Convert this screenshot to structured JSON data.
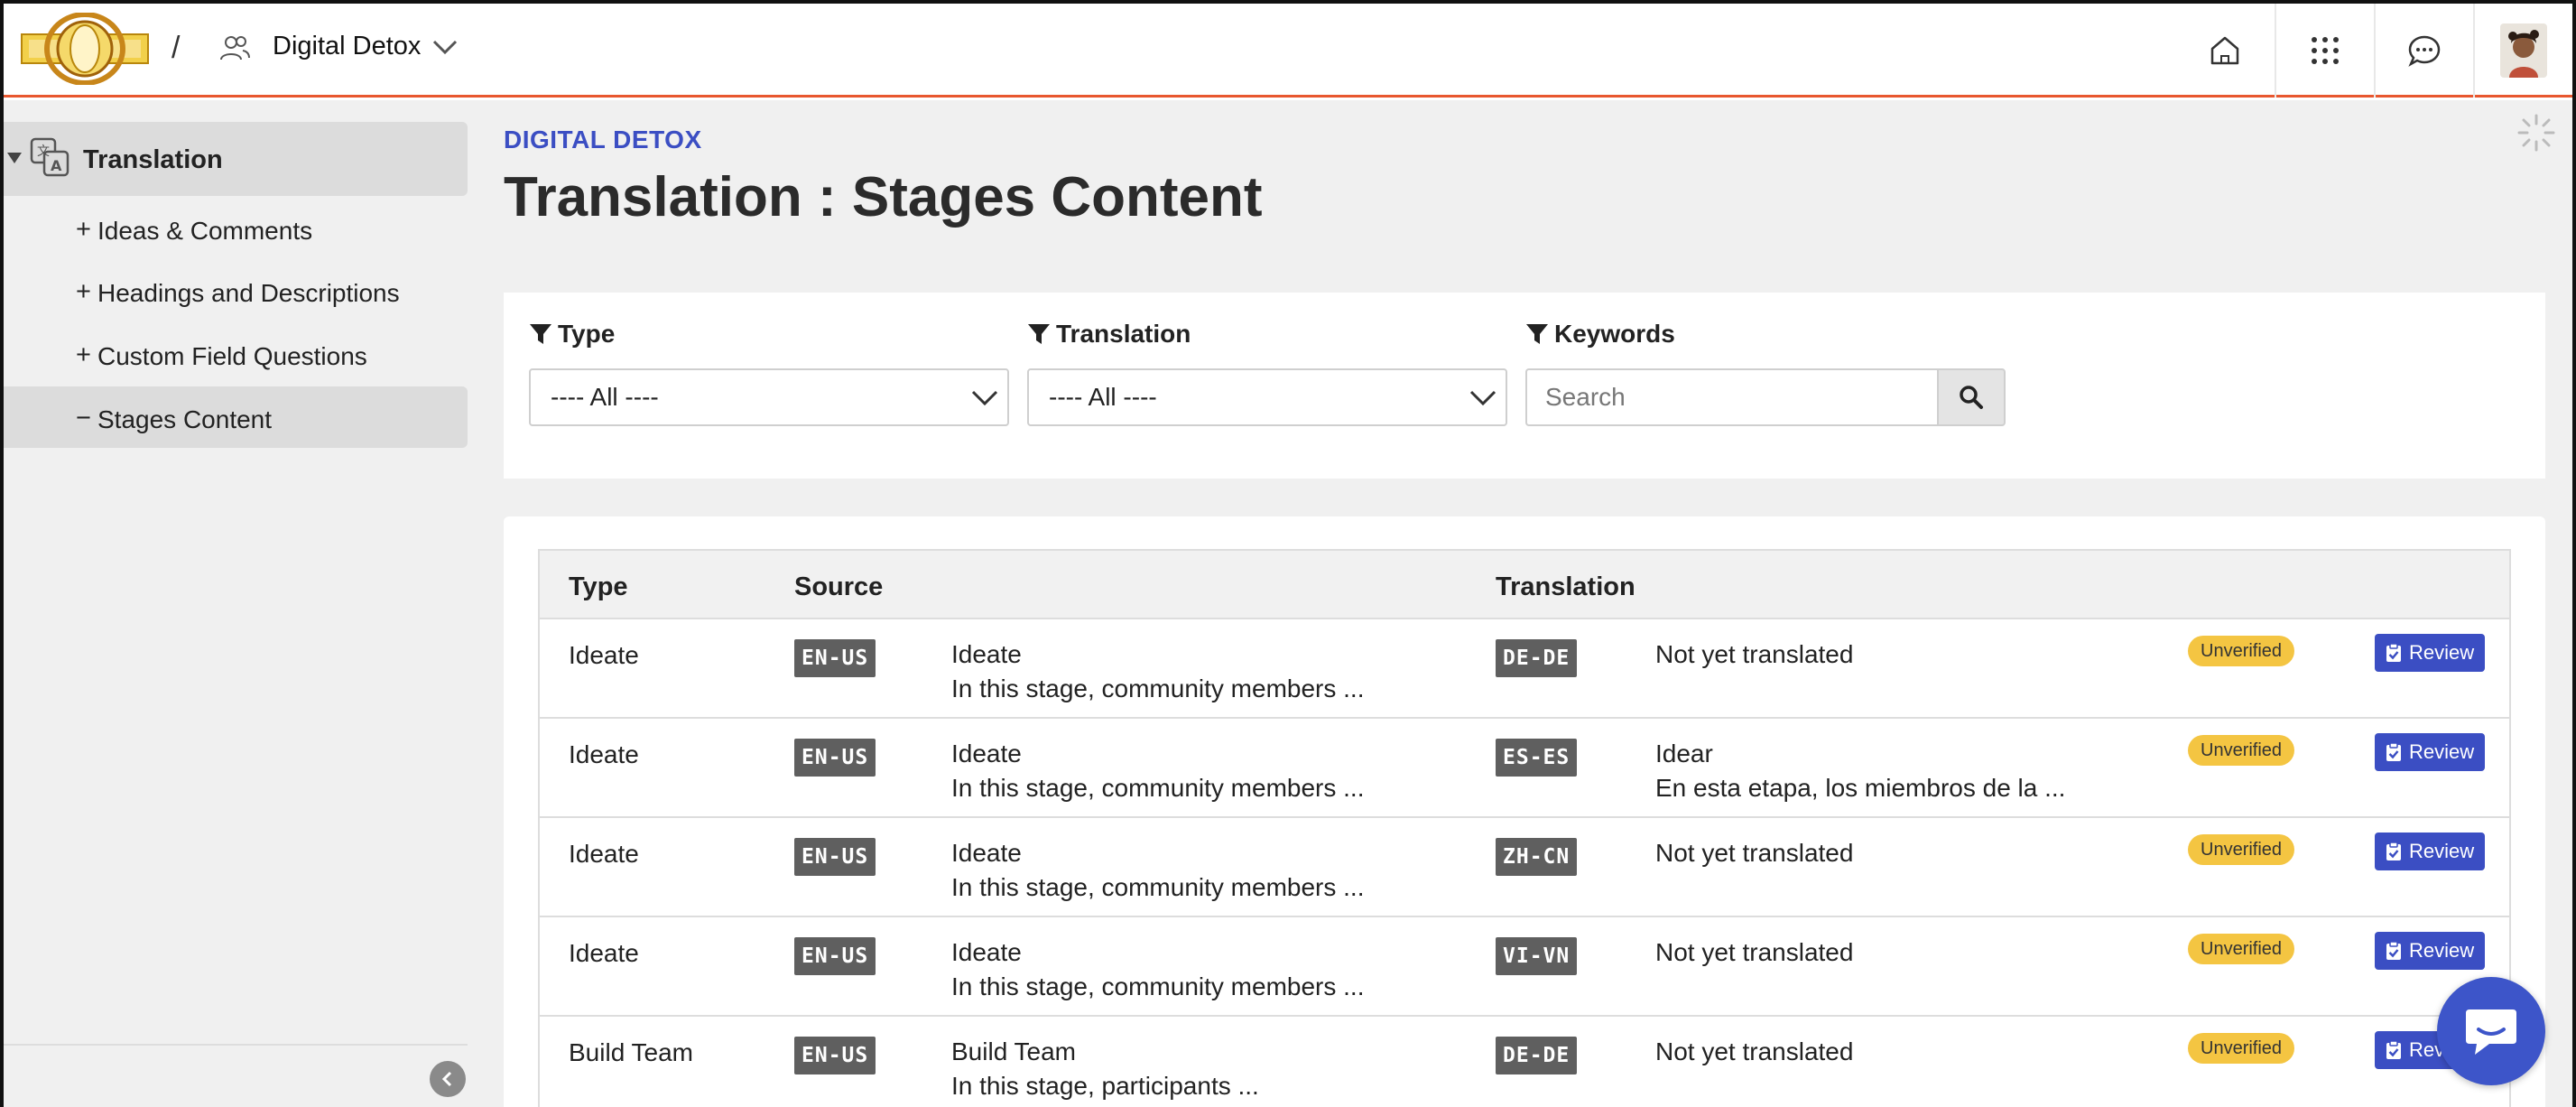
{
  "header": {
    "separator": "/",
    "project_name": "Digital Detox"
  },
  "sidebar": {
    "parent_label": "Translation",
    "items": [
      {
        "sign": "+",
        "label": "Ideas & Comments"
      },
      {
        "sign": "+",
        "label": "Headings and Descriptions"
      },
      {
        "sign": "+",
        "label": "Custom Field Questions"
      },
      {
        "sign": "−",
        "label": "Stages Content"
      }
    ]
  },
  "main": {
    "project_label": "DIGITAL DETOX",
    "title": "Translation : Stages Content"
  },
  "filters": {
    "type_label": "Type",
    "type_value": "---- All ----",
    "translation_label": "Translation",
    "translation_value": "---- All ----",
    "keywords_label": "Keywords",
    "search_placeholder": "Search"
  },
  "table": {
    "headers": {
      "type": "Type",
      "source": "Source",
      "translation": "Translation"
    },
    "rows": [
      {
        "type": "Ideate",
        "src_lang": "EN-US",
        "src_title": "Ideate",
        "src_desc": "In this stage, community members ...",
        "tr_lang": "DE-DE",
        "tr_title": "Not yet translated",
        "tr_desc": "",
        "status": "Unverified",
        "action": "Review"
      },
      {
        "type": "Ideate",
        "src_lang": "EN-US",
        "src_title": "Ideate",
        "src_desc": "In this stage, community members ...",
        "tr_lang": "ES-ES",
        "tr_title": "Idear",
        "tr_desc": "En esta etapa, los miembros de la ...",
        "status": "Unverified",
        "action": "Review"
      },
      {
        "type": "Ideate",
        "src_lang": "EN-US",
        "src_title": "Ideate",
        "src_desc": "In this stage, community members ...",
        "tr_lang": "ZH-CN",
        "tr_title": "Not yet translated",
        "tr_desc": "",
        "status": "Unverified",
        "action": "Review"
      },
      {
        "type": "Ideate",
        "src_lang": "EN-US",
        "src_title": "Ideate",
        "src_desc": "In this stage, community members ...",
        "tr_lang": "VI-VN",
        "tr_title": "Not yet translated",
        "tr_desc": "",
        "status": "Unverified",
        "action": "Review"
      },
      {
        "type": "Build Team",
        "src_lang": "EN-US",
        "src_title": "Build Team",
        "src_desc": "In this stage, participants ...",
        "tr_lang": "DE-DE",
        "tr_title": "Not yet translated",
        "tr_desc": "",
        "status": "Unverified",
        "action": "Review"
      }
    ]
  },
  "colors": {
    "accent_blue": "#3b4ec3",
    "header_underline": "#e8572f",
    "status_yellow": "#f4c542",
    "badge_gray": "#5f5f5f"
  },
  "icons": [
    "home-icon",
    "apps-grid-icon",
    "chat-icon",
    "user-avatar",
    "people-icon",
    "translate-icon",
    "filter-icon",
    "search-icon",
    "chevron-left-icon",
    "loading-spinner-icon",
    "messenger-icon"
  ]
}
